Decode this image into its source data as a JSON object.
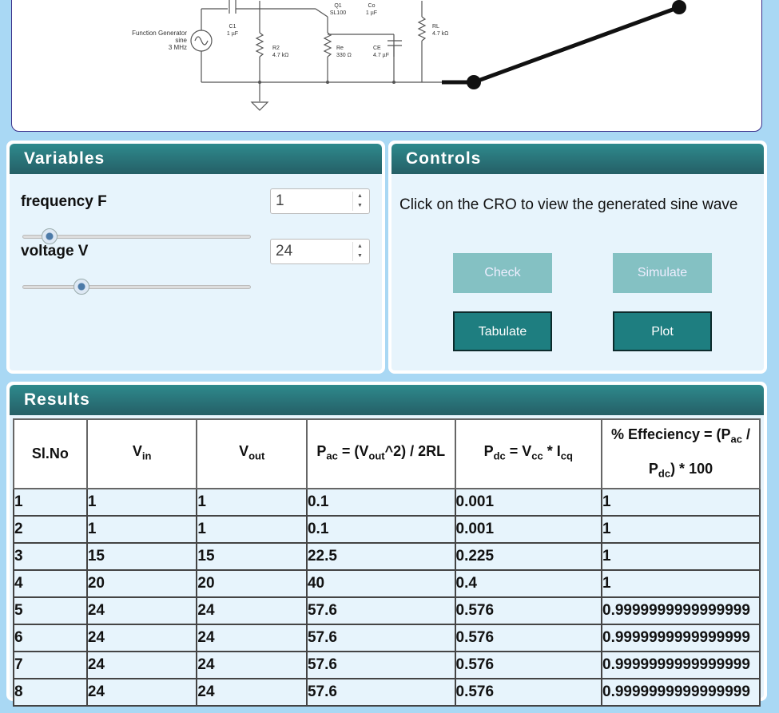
{
  "circuit": {
    "generator": {
      "line1": "Function Generator",
      "line2": "sine",
      "line3": "3 MHz"
    },
    "c1": {
      "name": "C1",
      "value": "1 µF"
    },
    "q1": {
      "name": "Q1",
      "value": "SL100"
    },
    "co": {
      "name": "Co",
      "value": "1 µF"
    },
    "rl": {
      "name": "RL",
      "value": "4.7 kΩ"
    },
    "r2": {
      "name": "R2",
      "value": "4.7 kΩ"
    },
    "re": {
      "name": "Re",
      "value": "330 Ω"
    },
    "ce": {
      "name": "CE",
      "value": "4.7 µF"
    }
  },
  "variables": {
    "title": "Variables",
    "frequency": {
      "label": "frequency F",
      "value": "1",
      "slider_fraction": 0.08
    },
    "voltage": {
      "label": "voltage V",
      "value": "24",
      "slider_fraction": 0.22
    }
  },
  "controls": {
    "title": "Controls",
    "message": "Click on the CRO to view the generated sine wave",
    "check": "Check",
    "simulate": "Simulate",
    "tabulate": "Tabulate",
    "plot": "Plot"
  },
  "results": {
    "title": "Results",
    "headers": {
      "slno": "Sl.No",
      "vin": "V",
      "vin_sub": "in",
      "vout": "V",
      "vout_sub": "out",
      "pac_a": "P",
      "pac_sub": "ac",
      "pac_b": " = (V",
      "pac_sub2": "out",
      "pac_c": "^2) / 2RL",
      "pdc_a": "P",
      "pdc_sub": "dc",
      "pdc_b": " = V",
      "pdc_sub2": "cc",
      "pdc_c": " * I",
      "pdc_sub3": "cq",
      "eff_a": "% Effeciency = (P",
      "eff_sub": "ac",
      "eff_b": " / P",
      "eff_sub2": "dc",
      "eff_c": ") * 100"
    },
    "rows": [
      [
        "1",
        "1",
        "1",
        "0.1",
        "0.001",
        "1"
      ],
      [
        "2",
        "1",
        "1",
        "0.1",
        "0.001",
        "1"
      ],
      [
        "3",
        "15",
        "15",
        "22.5",
        "0.225",
        "1"
      ],
      [
        "4",
        "20",
        "20",
        "40",
        "0.4",
        "1"
      ],
      [
        "5",
        "24",
        "24",
        "57.6",
        "0.576",
        "0.9999999999999999"
      ],
      [
        "6",
        "24",
        "24",
        "57.6",
        "0.576",
        "0.9999999999999999"
      ],
      [
        "7",
        "24",
        "24",
        "57.6",
        "0.576",
        "0.9999999999999999"
      ],
      [
        "8",
        "24",
        "24",
        "57.6",
        "0.576",
        "0.9999999999999999"
      ]
    ]
  }
}
